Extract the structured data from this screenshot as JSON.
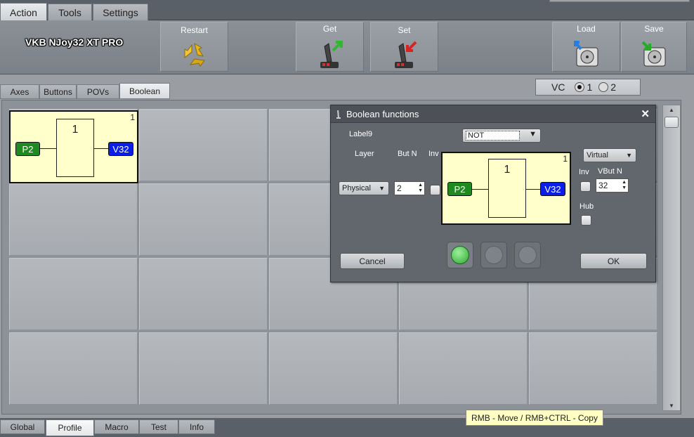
{
  "top_tabs": [
    "Action",
    "Tools",
    "Settings"
  ],
  "device_name": "VKB NJoy32 XT PRO",
  "toolbar": {
    "restart": "Restart",
    "get": "Get",
    "set": "Set",
    "load": "Load",
    "save": "Save"
  },
  "sub_tabs": [
    "Axes",
    "Buttons",
    "POVs",
    "Boolean"
  ],
  "vc": {
    "label": "VC",
    "opt1": "1",
    "opt2": "2",
    "selected": "1"
  },
  "grid_block": {
    "number": "1",
    "gate": "1",
    "input": "P2",
    "output": "V32"
  },
  "bottom_tabs": [
    "Global",
    "Profile",
    "Macro",
    "Test",
    "Info"
  ],
  "tooltip": "RMB - Move  /  RMB+CTRL - Copy",
  "dialog": {
    "title": "Boolean functions",
    "close": "✕",
    "label9": "Label9",
    "function": "NOT",
    "layer_label": "Layer",
    "butn_label": "But N",
    "inv_label": "Inv",
    "layer_value": "Physical",
    "butn_value": "2",
    "virtual_value": "Virtual",
    "inv2_label": "Inv",
    "vbutn_label": "VBut N",
    "vbutn_value": "32",
    "hub_label": "Hub",
    "preview": {
      "number": "1",
      "gate": "1",
      "input": "P2",
      "output": "V32"
    },
    "cancel": "Cancel",
    "ok": "OK"
  }
}
